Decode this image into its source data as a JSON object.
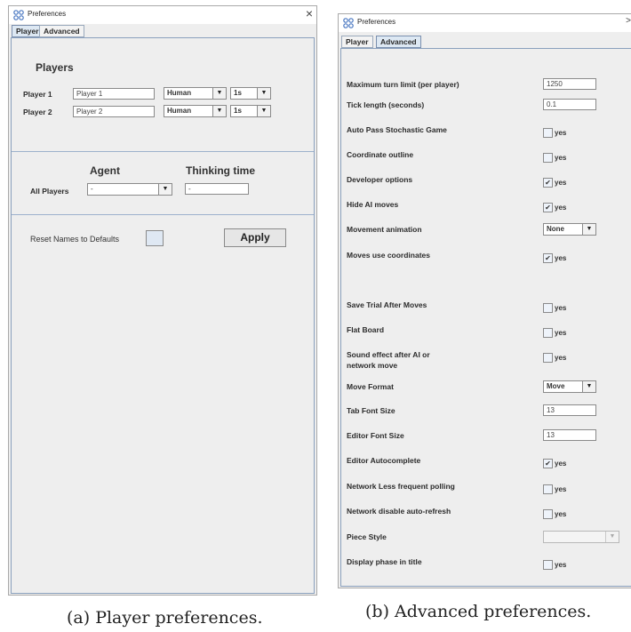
{
  "left": {
    "window_title": "Preferences",
    "close_glyph": "×",
    "tabs": [
      "Player",
      "Advanced"
    ],
    "players_heading": "Players",
    "players": [
      {
        "label": "Player 1",
        "name": "Player 1",
        "type": "Human",
        "time": "1s"
      },
      {
        "label": "Player 2",
        "name": "Player 2",
        "type": "Human",
        "time": "1s"
      }
    ],
    "agent_heading": "Agent",
    "thinking_heading": "Thinking time",
    "all_players_label": "All Players",
    "agent_value": "-",
    "thinking_value": "-",
    "reset_label": "Reset Names to Defaults",
    "apply_label": "Apply",
    "dropdown_arrow": "▼"
  },
  "right": {
    "window_title": "Preferences",
    "close_glyph": ">",
    "tabs": [
      "Player",
      "Advanced"
    ],
    "yes": "yes",
    "check_mark": "✔",
    "dropdown_arrow": "▼",
    "rows": [
      {
        "label": "Maximum turn limit (per player)",
        "kind": "text",
        "value": "1250"
      },
      {
        "label": "Tick length (seconds)",
        "kind": "text",
        "value": "0.1"
      },
      {
        "label": "Auto Pass Stochastic Game",
        "kind": "check",
        "checked": false
      },
      {
        "label": "Coordinate outline",
        "kind": "check",
        "checked": false
      },
      {
        "label": "Developer options",
        "kind": "check",
        "checked": true
      },
      {
        "label": "Hide AI moves",
        "kind": "check",
        "checked": true
      },
      {
        "label": "Movement animation",
        "kind": "combo",
        "value": "None"
      },
      {
        "label": "Moves use coordinates",
        "kind": "check",
        "checked": true
      },
      {
        "label": "Save Trial After Moves",
        "kind": "check",
        "checked": false
      },
      {
        "label": "Flat Board",
        "kind": "check",
        "checked": false
      },
      {
        "label": "Sound effect after AI or",
        "label2": "network move",
        "kind": "check",
        "checked": false
      },
      {
        "label": "Move Format",
        "kind": "combo",
        "value": "Move"
      },
      {
        "label": "Tab Font Size",
        "kind": "text",
        "value": "13"
      },
      {
        "label": "Editor Font Size",
        "kind": "text",
        "value": "13"
      },
      {
        "label": "Editor Autocomplete",
        "kind": "check",
        "checked": true
      },
      {
        "label": "Network Less frequent polling",
        "kind": "check",
        "checked": false
      },
      {
        "label": "Network disable auto-refresh",
        "kind": "check",
        "checked": false
      },
      {
        "label": "Piece Style",
        "kind": "combo-disabled",
        "value": ""
      },
      {
        "label": "Display phase in title",
        "kind": "check",
        "checked": false
      }
    ]
  },
  "captions": {
    "a": "(a) Player preferences.",
    "b": "(b) Advanced preferences."
  }
}
